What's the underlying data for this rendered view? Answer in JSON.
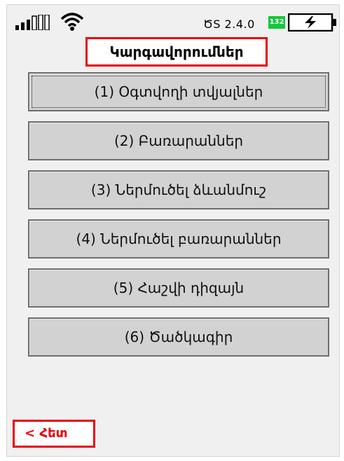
{
  "status_bar": {
    "signal_icon": "signal-bars-icon",
    "wifi_icon": "wifi-icon",
    "version": "ԾS 2.4.0",
    "battery_percent": "132",
    "battery_icon": "battery-charging-icon"
  },
  "title": "Կարգավորումներ",
  "menu": [
    {
      "label": "(1) Օգտվողի տվյալներ"
    },
    {
      "label": "(2) Բառարաններ"
    },
    {
      "label": "(3) Ներմուծել ձևանմուշ"
    },
    {
      "label": "(4) Ներմուծել բառարաններ"
    },
    {
      "label": "(5) Հաշվի դիզայն"
    },
    {
      "label": "(6) Ծածկագիր"
    }
  ],
  "back_button": {
    "label": "< Հետ"
  },
  "colors": {
    "accent_red": "#e8000a",
    "battery_green": "#14c83a",
    "button_gray": "#d2d2d2",
    "panel_bg": "#f0f0f0"
  }
}
